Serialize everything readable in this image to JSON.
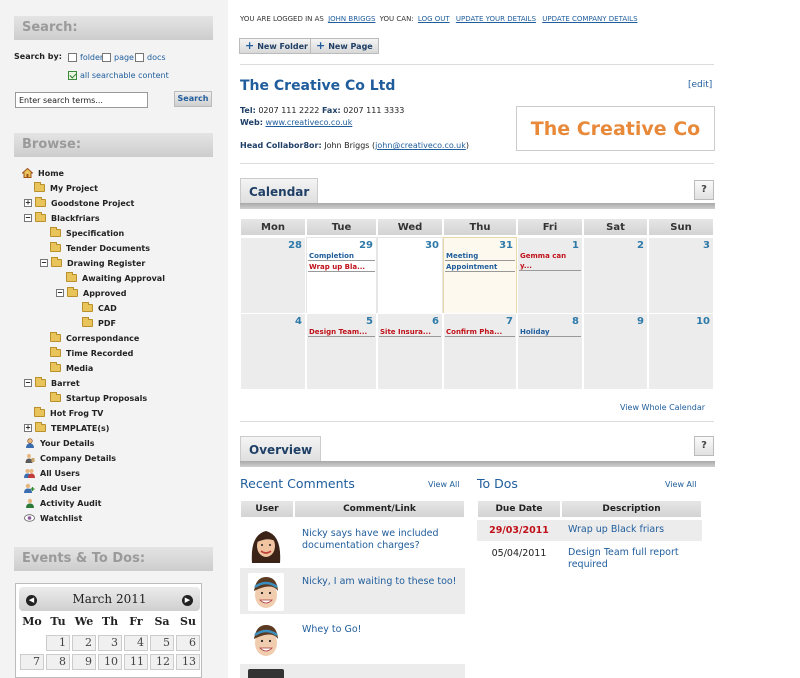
{
  "sidebar": {
    "search": {
      "title": "Search:",
      "search_by": "Search by:",
      "options": [
        "folder",
        "page",
        "docs"
      ],
      "all_content": "all searchable content",
      "input_value": "Enter search terms...",
      "button": "Search"
    },
    "browse": {
      "title": "Browse:",
      "tree": [
        {
          "label": "Home",
          "icon": "home-icon"
        },
        {
          "label": "My Project",
          "icon": "folder-icon"
        },
        {
          "label": "Goodstone Project",
          "icon": "folder-icon",
          "expander": "+"
        },
        {
          "label": "Blackfriars",
          "icon": "folder-icon",
          "expander": "−"
        },
        {
          "label": "Specification",
          "icon": "folder-icon"
        },
        {
          "label": "Tender Documents",
          "icon": "folder-icon"
        },
        {
          "label": "Drawing Register",
          "icon": "folder-open-icon",
          "expander": "−"
        },
        {
          "label": "Awaiting Approval",
          "icon": "folder-icon"
        },
        {
          "label": "Approved",
          "icon": "folder-open-icon",
          "expander": "−"
        },
        {
          "label": "CAD",
          "icon": "folder-icon"
        },
        {
          "label": "PDF",
          "icon": "folder-icon"
        },
        {
          "label": "Correspondance",
          "icon": "folder-icon"
        },
        {
          "label": "Time Recorded",
          "icon": "folder-icon"
        },
        {
          "label": "Media",
          "icon": "folder-icon"
        },
        {
          "label": "Barret",
          "icon": "folder-icon",
          "expander": "−"
        },
        {
          "label": "Startup Proposals",
          "icon": "folder-icon"
        },
        {
          "label": "Hot Frog TV",
          "icon": "folder-icon"
        },
        {
          "label": "TEMPLATE(s)",
          "icon": "folder-icon",
          "expander": "+"
        },
        {
          "label": "Your Details",
          "icon": "user-icon"
        },
        {
          "label": "Company Details",
          "icon": "company-icon"
        },
        {
          "label": "All Users",
          "icon": "users-icon"
        },
        {
          "label": "Add User",
          "icon": "add-user-icon"
        },
        {
          "label": "Activity Audit",
          "icon": "audit-icon"
        },
        {
          "label": "Watchlist",
          "icon": "eye-icon"
        }
      ]
    },
    "events": {
      "title": "Events & To Dos:",
      "month": "March 2011",
      "weekdays": [
        "Mo",
        "Tu",
        "We",
        "Th",
        "Fr",
        "Sa",
        "Su"
      ],
      "week1": [
        "",
        "1",
        "2",
        "3",
        "4",
        "5",
        "6"
      ],
      "week2": [
        "7",
        "8",
        "9",
        "10",
        "11",
        "12",
        "13"
      ]
    }
  },
  "header": {
    "logged_in_prefix": "YOU ARE LOGGED IN AS",
    "user": "JOHN BRIGGS",
    "can_text": "YOU CAN:",
    "links": [
      "LOG OUT",
      "UPDATE YOUR DETAILS",
      "UPDATE COMPANY DETAILS"
    ],
    "new_folder": "New Folder",
    "new_page": "New Page"
  },
  "company": {
    "name": "The Creative Co Ltd",
    "edit": "[edit]",
    "tel_label": "Tel:",
    "tel": "0207 111 2222",
    "fax_label": "Fax:",
    "fax": "0207 111 3333",
    "web_label": "Web:",
    "web": "www.creativeco.co.uk",
    "collab_label": "Head Collabor8or:",
    "collab_name": "John Briggs",
    "collab_email": "john@creativeco.co.uk",
    "logo_text": "The Creative Co"
  },
  "calendar": {
    "title": "Calendar",
    "help": "?",
    "days": [
      "Mon",
      "Tue",
      "Wed",
      "Thu",
      "Fri",
      "Sat",
      "Sun"
    ],
    "week1": [
      "28",
      "29",
      "30",
      "31",
      "1",
      "2",
      "3"
    ],
    "week2": [
      "4",
      "5",
      "6",
      "7",
      "8",
      "9",
      "10"
    ],
    "events": {
      "tue1a": "Completion",
      "tue1b": "Wrap up Bla...",
      "thu1a": "Meeting",
      "thu1b": "Appointment",
      "fri1a": "Gemma can",
      "fri1b": "y...",
      "tue2": "Design Team...",
      "wed2": "Site Insura...",
      "thu2": "Confirm Pha...",
      "fri2": "Holiday"
    },
    "view_whole": "View Whole Calendar"
  },
  "overview": {
    "title": "Overview",
    "help": "?",
    "recent_comments": {
      "title": "Recent Comments",
      "view_all": "View All",
      "col_user": "User",
      "col_comment": "Comment/Link",
      "rows": [
        {
          "text": "Nicky says have we included documentation charges?"
        },
        {
          "text": "Nicky, I am waiting to these too!"
        },
        {
          "text": "Whey to Go!"
        }
      ]
    },
    "todos": {
      "title": "To Dos",
      "view_all": "View All",
      "col_due": "Due Date",
      "col_desc": "Description",
      "rows": [
        {
          "due": "29/03/2011",
          "desc": "Wrap up Black friars"
        },
        {
          "due": "05/04/2011",
          "desc": "Design Team full report required"
        }
      ]
    }
  },
  "colors": {
    "link_blue": "#1f5d9c",
    "overdue_red": "#c0121a",
    "logo_orange": "#e8893a"
  }
}
